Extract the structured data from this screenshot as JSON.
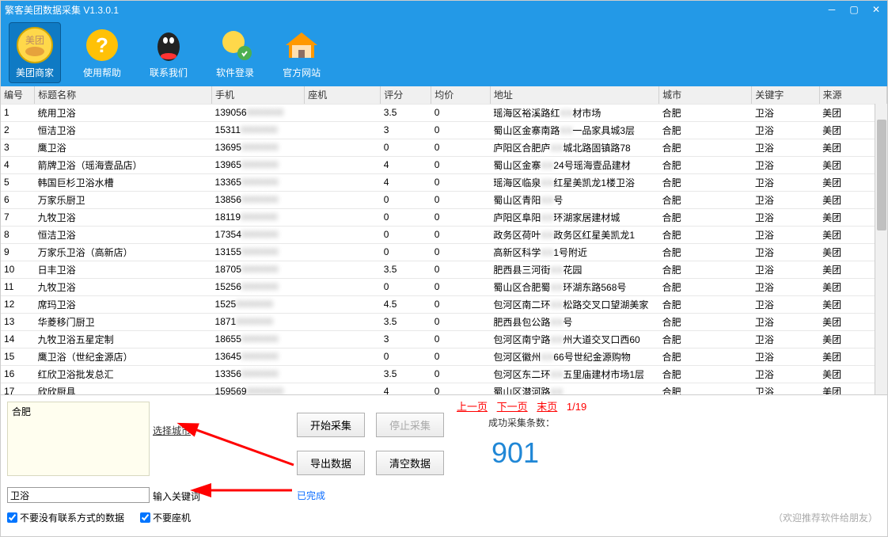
{
  "title": "繁客美团数据采集 V1.3.0.1",
  "toolbar": {
    "items": [
      "美团商家",
      "使用帮助",
      "联系我们",
      "软件登录",
      "官方网站"
    ]
  },
  "columns": [
    "编号",
    "标题名称",
    "手机",
    "座机",
    "评分",
    "均价",
    "地址",
    "城市",
    "关键字",
    "来源"
  ],
  "rows": [
    {
      "n": "1",
      "name": "统用卫浴",
      "phone": "139056",
      "rate": "3.5",
      "price": "0",
      "addr_a": "瑶海区裕溪路红",
      "addr_b": "材市场",
      "city": "合肥",
      "kw": "卫浴",
      "src": "美团"
    },
    {
      "n": "2",
      "name": "恒洁卫浴",
      "phone": "15311",
      "rate": "3",
      "price": "0",
      "addr_a": "蜀山区金寨南路",
      "addr_b": "一品家具城3层",
      "city": "合肥",
      "kw": "卫浴",
      "src": "美团"
    },
    {
      "n": "3",
      "name": "鹰卫浴",
      "phone": "13695",
      "rate": "0",
      "price": "0",
      "addr_a": "庐阳区合肥庐",
      "addr_b": "城北路固镇路78",
      "city": "合肥",
      "kw": "卫浴",
      "src": "美团"
    },
    {
      "n": "4",
      "name": "箭牌卫浴（瑶海壹品店）",
      "phone": "13965",
      "rate": "4",
      "price": "0",
      "addr_a": "蜀山区金寨",
      "addr_b": "24号瑶海壹品建材",
      "city": "合肥",
      "kw": "卫浴",
      "src": "美团"
    },
    {
      "n": "5",
      "name": "韩国巨杉卫浴水槽",
      "phone": "13365",
      "rate": "4",
      "price": "0",
      "addr_a": "瑶海区临泉",
      "addr_b": "红星美凯龙1楼卫浴",
      "city": "合肥",
      "kw": "卫浴",
      "src": "美团"
    },
    {
      "n": "6",
      "name": "万家乐厨卫",
      "phone": "13856",
      "rate": "0",
      "price": "0",
      "addr_a": "蜀山区青阳",
      "addr_b": "号",
      "city": "合肥",
      "kw": "卫浴",
      "src": "美团"
    },
    {
      "n": "7",
      "name": "九牧卫浴",
      "phone": "18119",
      "rate": "0",
      "price": "0",
      "addr_a": "庐阳区阜阳",
      "addr_b": "环湖家居建材城",
      "city": "合肥",
      "kw": "卫浴",
      "src": "美团"
    },
    {
      "n": "8",
      "name": "恒洁卫浴",
      "phone": "17354",
      "rate": "0",
      "price": "0",
      "addr_a": "政务区荷叶",
      "addr_b": "政务区红星美凯龙1",
      "city": "合肥",
      "kw": "卫浴",
      "src": "美团"
    },
    {
      "n": "9",
      "name": "万家乐卫浴（高新店）",
      "phone": "13155",
      "rate": "0",
      "price": "0",
      "addr_a": "高新区科学",
      "addr_b": "1号附近",
      "city": "合肥",
      "kw": "卫浴",
      "src": "美团"
    },
    {
      "n": "10",
      "name": "日丰卫浴",
      "phone": "18705",
      "rate": "3.5",
      "price": "0",
      "addr_a": "肥西县三河街",
      "addr_b": "花园",
      "city": "合肥",
      "kw": "卫浴",
      "src": "美团"
    },
    {
      "n": "11",
      "name": "九牧卫浴",
      "phone": "15256",
      "rate": "0",
      "price": "0",
      "addr_a": "蜀山区合肥蜀",
      "addr_b": "环湖东路568号",
      "city": "合肥",
      "kw": "卫浴",
      "src": "美团"
    },
    {
      "n": "12",
      "name": "席玛卫浴",
      "phone": "1525",
      "rate": "4.5",
      "price": "0",
      "addr_a": "包河区南二环",
      "addr_b": "松路交叉口望湖美家",
      "city": "合肥",
      "kw": "卫浴",
      "src": "美团"
    },
    {
      "n": "13",
      "name": "华菱移门厨卫",
      "phone": "1871",
      "rate": "3.5",
      "price": "0",
      "addr_a": "肥西县包公路",
      "addr_b": "号",
      "city": "合肥",
      "kw": "卫浴",
      "src": "美团"
    },
    {
      "n": "14",
      "name": "九牧卫浴五星定制",
      "phone": "18655",
      "rate": "3",
      "price": "0",
      "addr_a": "包河区南宁路",
      "addr_b": "州大道交叉口西60",
      "city": "合肥",
      "kw": "卫浴",
      "src": "美团"
    },
    {
      "n": "15",
      "name": "鹰卫浴（世纪金源店）",
      "phone": "13645",
      "rate": "0",
      "price": "0",
      "addr_a": "包河区徽州",
      "addr_b": "66号世纪金源购物",
      "city": "合肥",
      "kw": "卫浴",
      "src": "美团"
    },
    {
      "n": "16",
      "name": "红欣卫浴批发总汇",
      "phone": "13356",
      "rate": "3.5",
      "price": "0",
      "addr_a": "包河区东二环",
      "addr_b": "五里庙建材市场1层",
      "city": "合肥",
      "kw": "卫浴",
      "src": "美团"
    },
    {
      "n": "17",
      "name": "欣欣厨具",
      "phone": "159569",
      "rate": "4",
      "price": "0",
      "addr_a": "蜀山区潜河路",
      "addr_b": "",
      "city": "合肥",
      "kw": "卫浴",
      "src": "美团"
    }
  ],
  "bottom": {
    "city": "合肥",
    "cityLabel": "选择城市",
    "keyword": "卫浴",
    "kwLabel": "输入关键词",
    "check1": "不要没有联系方式的数据",
    "check2": "不要座机",
    "start": "开始采集",
    "stop": "停止采集",
    "export": "导出数据",
    "clear": "清空数据",
    "done": "已完成",
    "prev": "上一页",
    "next": "下一页",
    "last": "末页",
    "page": "1/19",
    "countLabel": "成功采集条数：",
    "count": "901",
    "recommend": "（欢迎推荐软件给朋友）"
  }
}
